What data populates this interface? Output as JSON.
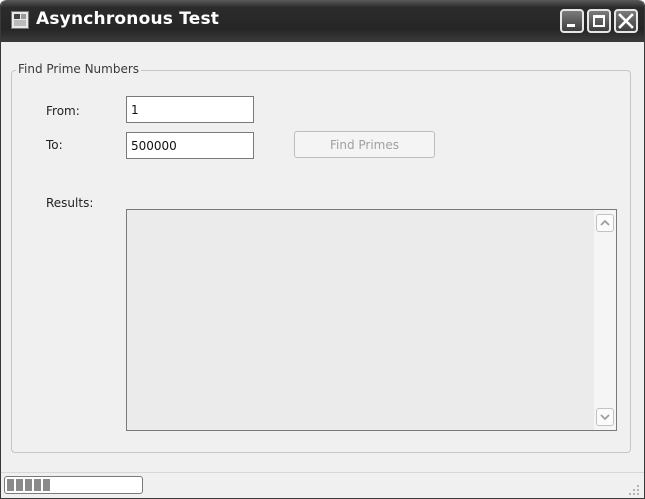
{
  "window": {
    "title": "Asynchronous Test",
    "icon": "app-window-icon",
    "controls": [
      "minimize-icon",
      "maximize-icon",
      "close-icon"
    ]
  },
  "group": {
    "legend": "Find Prime Numbers"
  },
  "form": {
    "from_label": "From:",
    "from_value": "1",
    "to_label": "To:",
    "to_value": "500000",
    "find_button_label": "Find Primes",
    "find_button_enabled": false,
    "results_label": "Results:",
    "results_value": ""
  },
  "statusbar": {
    "progress_blocks": 5,
    "grip_icon": "resize-grip-icon"
  }
}
